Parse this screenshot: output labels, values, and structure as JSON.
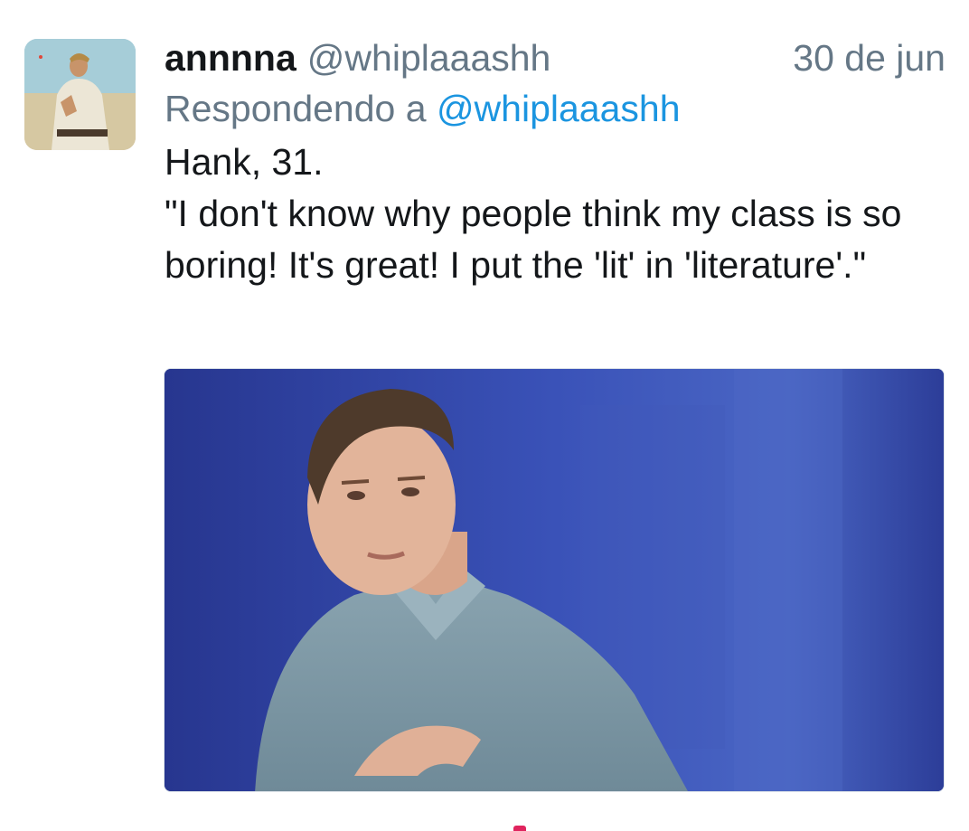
{
  "tweet": {
    "display_name": "annnna",
    "handle": "@whiplaaashh",
    "date": "30 de jun",
    "reply_prefix": "Respondendo a",
    "reply_to": "@whiplaaashh",
    "text": "Hank, 31.\n\"I don't know why people think my class is so boring! It's great! I put the 'lit' in 'literature'.\""
  },
  "colors": {
    "secondary_text": "#657786",
    "link": "#1b95e0",
    "primary_text": "#14171a"
  },
  "icons": {
    "avatar": "profile-avatar-image",
    "media": "attached-gif-image",
    "like": "heart-icon"
  }
}
